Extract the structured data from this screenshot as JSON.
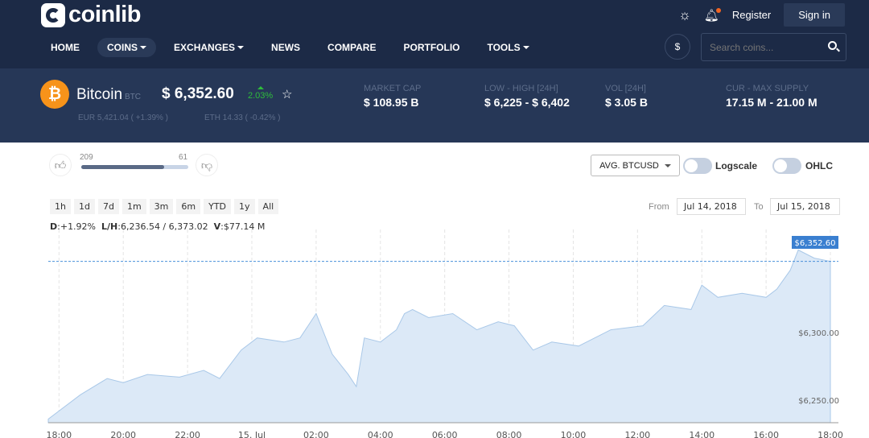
{
  "brand": {
    "name": "coinlib"
  },
  "nav": {
    "items": [
      {
        "label": "HOME"
      },
      {
        "label": "COINS",
        "dropdown": true,
        "active": true
      },
      {
        "label": "EXCHANGES",
        "dropdown": true
      },
      {
        "label": "NEWS"
      },
      {
        "label": "COMPARE"
      },
      {
        "label": "PORTFOLIO"
      },
      {
        "label": "TOOLS",
        "dropdown": true
      }
    ],
    "register": "Register",
    "signin": "Sign in",
    "currency": "$",
    "search_placeholder": "Search coins...",
    "icons": [
      "sun-icon",
      "bell-icon",
      "search-icon"
    ]
  },
  "coin": {
    "name": "Bitcoin",
    "symbol": "BTC",
    "price": "$ 6,352.60",
    "change": "2.03%",
    "eur": "EUR 5,421.04 ( +1.39% )",
    "eth": "ETH 14.33 ( -0.42% )",
    "stats": [
      {
        "label": "MARKET CAP",
        "value": "$ 108.95 B"
      },
      {
        "label": "LOW - HIGH [24H]",
        "value": "$ 6,225 - $ 6,402"
      },
      {
        "label": "VOL [24H]",
        "value": "$ 3.05 B"
      },
      {
        "label": "CUR - MAX SUPPLY",
        "value": "17.15 M - 21.00 M"
      }
    ]
  },
  "votes": {
    "up": "209",
    "down": "61",
    "up_fraction": 0.774
  },
  "controls": {
    "pair": "AVG. BTCUSD",
    "logscale": "Logscale",
    "logscale_on": false,
    "ohlc": "OHLC",
    "ohlc_on": false,
    "ranges": [
      "1h",
      "1d",
      "7d",
      "1m",
      "3m",
      "6m",
      "YTD",
      "1y",
      "All"
    ],
    "from_label": "From",
    "from": "Jul 14, 2018",
    "to_label": "To",
    "to": "Jul 15, 2018"
  },
  "info": {
    "d_label": "D",
    "d": ":+1.92%",
    "lh_label": "L/H",
    "lh": ":6,236.54 / 6,373.02",
    "v_label": "V",
    "v": ":$77.14 M"
  },
  "chart_data": {
    "type": "area",
    "line_color": "#a9c8e8",
    "fill_color": "#dce9f7",
    "grid": "vertical dashed",
    "current_label": "$6,352.60",
    "current_value": 6352.6,
    "ylim": [
      6233,
      6375
    ],
    "yticks": [
      {
        "v": 6300,
        "label": "$6,300.00"
      },
      {
        "v": 6250,
        "label": "$6,250.00"
      }
    ],
    "xticks": [
      "18:00",
      "20:00",
      "22:00",
      "15. Jul",
      "02:00",
      "04:00",
      "06:00",
      "08:00",
      "10:00",
      "12:00",
      "14:00",
      "16:00",
      "18:00"
    ],
    "xrange": [
      "2018-07-14T17:40",
      "2018-07-15T18:15"
    ],
    "points": [
      [
        "2018-07-14T17:40",
        6236
      ],
      [
        "2018-07-14T18:40",
        6254
      ],
      [
        "2018-07-14T19:30",
        6266
      ],
      [
        "2018-07-14T20:00",
        6263
      ],
      [
        "2018-07-14T20:45",
        6269
      ],
      [
        "2018-07-14T21:45",
        6267
      ],
      [
        "2018-07-14T22:30",
        6272
      ],
      [
        "2018-07-14T23:00",
        6266
      ],
      [
        "2018-07-14T23:40",
        6287
      ],
      [
        "2018-07-15T00:10",
        6296
      ],
      [
        "2018-07-15T01:00",
        6293
      ],
      [
        "2018-07-15T01:30",
        6296
      ],
      [
        "2018-07-15T02:00",
        6314
      ],
      [
        "2018-07-15T02:30",
        6284
      ],
      [
        "2018-07-15T03:00",
        6269
      ],
      [
        "2018-07-15T03:15",
        6260
      ],
      [
        "2018-07-15T03:30",
        6296
      ],
      [
        "2018-07-15T04:00",
        6293
      ],
      [
        "2018-07-15T04:30",
        6302
      ],
      [
        "2018-07-15T04:45",
        6314
      ],
      [
        "2018-07-15T05:00",
        6317
      ],
      [
        "2018-07-15T05:30",
        6311
      ],
      [
        "2018-07-15T06:15",
        6314
      ],
      [
        "2018-07-15T07:00",
        6302
      ],
      [
        "2018-07-15T07:40",
        6308
      ],
      [
        "2018-07-15T08:10",
        6305
      ],
      [
        "2018-07-15T08:45",
        6287
      ],
      [
        "2018-07-15T09:20",
        6293
      ],
      [
        "2018-07-15T10:10",
        6290
      ],
      [
        "2018-07-15T11:10",
        6302
      ],
      [
        "2018-07-15T12:10",
        6305
      ],
      [
        "2018-07-15T12:50",
        6320
      ],
      [
        "2018-07-15T13:40",
        6317
      ],
      [
        "2018-07-15T14:00",
        6335
      ],
      [
        "2018-07-15T14:30",
        6326
      ],
      [
        "2018-07-15T15:15",
        6329
      ],
      [
        "2018-07-15T16:00",
        6326
      ],
      [
        "2018-07-15T16:20",
        6332
      ],
      [
        "2018-07-15T16:45",
        6346
      ],
      [
        "2018-07-15T17:00",
        6361
      ],
      [
        "2018-07-15T17:30",
        6355
      ],
      [
        "2018-07-15T18:00",
        6352.6
      ]
    ]
  }
}
